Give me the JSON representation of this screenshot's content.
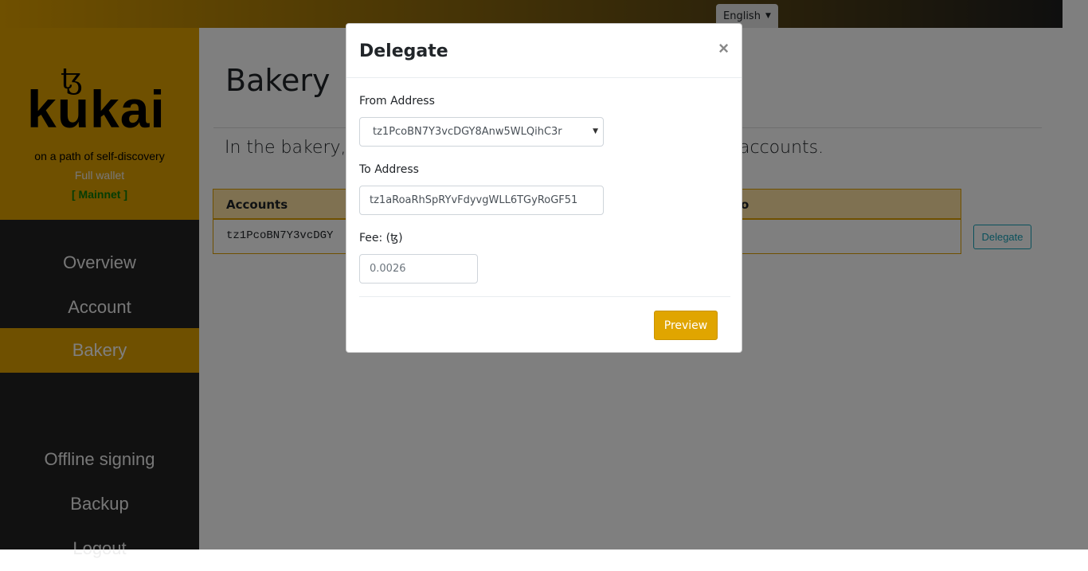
{
  "topbar": {
    "language": "English"
  },
  "sidebar": {
    "logo_mark": "ꜩ",
    "logo_text": "kukai",
    "tagline": "on a path of self-discovery",
    "wallet_type": "Full wallet",
    "network": "[ Mainnet ]",
    "items": [
      {
        "label": "Overview"
      },
      {
        "label": "Account"
      },
      {
        "label": "Bakery",
        "active": true
      },
      {
        "label": "Offline signing"
      },
      {
        "label": "Backup"
      },
      {
        "label": "Logout"
      }
    ]
  },
  "main": {
    "title": "Bakery",
    "lead_left": "In the bakery, y",
    "lead_right": "accounts.",
    "table": {
      "col1": "Accounts",
      "col2": "o",
      "row_account": "tz1PcoBN7Y3vcDGY"
    },
    "delegate_button": "Delegate"
  },
  "modal": {
    "title": "Delegate",
    "close": "×",
    "from_label": "From Address",
    "from_value": "tz1PcoBN7Y3vcDGY8Anw5WLQihC3r",
    "to_label": "To Address",
    "to_value": "tz1aRoaRhSpRYvFdyvgWLL6TGyRoGF51",
    "fee_label": "Fee: (ꜩ)",
    "fee_placeholder": "0.0026",
    "preview": "Preview"
  },
  "colors": {
    "brand": "#dfa000",
    "sidebar": "#222222",
    "network": "#0b7a0b"
  }
}
